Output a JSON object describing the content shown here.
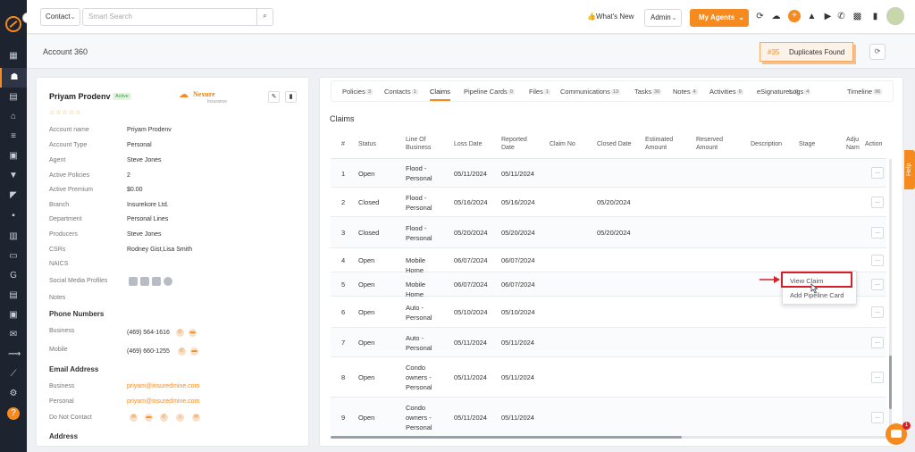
{
  "topbar": {
    "entity_select": "Contact",
    "search_placeholder": "Smart Search",
    "whats_new": "What's New",
    "role_select": "Admin",
    "my_agents": "My Agents",
    "notification_count": "1"
  },
  "subhead": {
    "title": "Account 360",
    "duplicates_count": "#35",
    "duplicates_label": "Duplicates Found"
  },
  "account": {
    "name": "Priyam Prodenv",
    "status": "Active",
    "brand": "Nexure",
    "brand_sub": "Insurance",
    "fields": [
      {
        "label": "Account name",
        "value": "Priyam Prodenv"
      },
      {
        "label": "Account Type",
        "value": "Personal"
      },
      {
        "label": "Agent",
        "value": "Steve Jones"
      },
      {
        "label": "Active Policies",
        "value": "2"
      },
      {
        "label": "Active Premium",
        "value": "$0.00"
      },
      {
        "label": "Branch",
        "value": "Insurekore Ltd."
      },
      {
        "label": "Department",
        "value": "Personal Lines"
      },
      {
        "label": "Producers",
        "value": "Steve Jones"
      },
      {
        "label": "CSRs",
        "value": "Rodney Gist,Lisa Smith"
      },
      {
        "label": "NAICS",
        "value": ""
      }
    ],
    "social_label": "Social Media Profiles",
    "notes_label": "Notes",
    "phone_section": "Phone Numbers",
    "phones": [
      {
        "label": "Business",
        "value": "(469) 564-1616"
      },
      {
        "label": "Mobile",
        "value": "(469) 660-1255"
      }
    ],
    "email_section": "Email Address",
    "emails": [
      {
        "label": "Business",
        "value": "priyam@insuredmine.com"
      },
      {
        "label": "Personal",
        "value": "priyam@insuredmine.com"
      }
    ],
    "dnc_label": "Do Not Contact",
    "address_section": "Address"
  },
  "tabs": [
    {
      "label": "Policies",
      "count": "3"
    },
    {
      "label": "Contacts",
      "count": "1"
    },
    {
      "label": "Claims",
      "count": ""
    },
    {
      "label": "Pipeline Cards",
      "count": "0"
    },
    {
      "label": "Files",
      "count": "1"
    },
    {
      "label": "Communications",
      "count": "13"
    },
    {
      "label": "Tasks",
      "count": "36"
    },
    {
      "label": "Notes",
      "count": "4"
    },
    {
      "label": "Activities",
      "count": "9"
    },
    {
      "label": "eSignatures",
      "count": "0"
    },
    {
      "label": "Logs",
      "count": "4"
    },
    {
      "label": "Timeline",
      "count": "96"
    }
  ],
  "claims": {
    "title": "Claims",
    "headers": {
      "num": "#",
      "status": "Status",
      "lob": "Line Of Business",
      "loss": "Loss Date",
      "reported": "Reported Date",
      "claimno": "Claim No",
      "closed": "Closed Date",
      "est": "Estimated Amount",
      "reserved": "Reserved Amount",
      "desc": "Description",
      "stage": "Stage",
      "adj": "Adju Nam",
      "action": "Action"
    },
    "rows": [
      {
        "num": "1",
        "status": "Open",
        "lob": "Flood - Personal",
        "loss": "05/11/2024",
        "reported": "05/11/2024",
        "closed": ""
      },
      {
        "num": "2",
        "status": "Closed",
        "lob": "Flood - Personal",
        "loss": "05/16/2024",
        "reported": "05/16/2024",
        "closed": "05/20/2024"
      },
      {
        "num": "3",
        "status": "Closed",
        "lob": "Flood - Personal",
        "loss": "05/20/2024",
        "reported": "05/20/2024",
        "closed": "05/20/2024"
      },
      {
        "num": "4",
        "status": "Open",
        "lob": "Mobile Home",
        "loss": "06/07/2024",
        "reported": "06/07/2024",
        "closed": ""
      },
      {
        "num": "5",
        "status": "Open",
        "lob": "Mobile Home",
        "loss": "06/07/2024",
        "reported": "06/07/2024",
        "closed": ""
      },
      {
        "num": "6",
        "status": "Open",
        "lob": "Auto - Personal",
        "loss": "05/10/2024",
        "reported": "05/10/2024",
        "closed": ""
      },
      {
        "num": "7",
        "status": "Open",
        "lob": "Auto - Personal",
        "loss": "05/11/2024",
        "reported": "05/11/2024",
        "closed": ""
      },
      {
        "num": "8",
        "status": "Open",
        "lob": "Condo owners - Personal",
        "loss": "05/11/2024",
        "reported": "05/11/2024",
        "closed": ""
      },
      {
        "num": "9",
        "status": "Open",
        "lob": "Condo owners - Personal",
        "loss": "05/11/2024",
        "reported": "05/11/2024",
        "closed": ""
      }
    ],
    "action_label": "..."
  },
  "context_menu": {
    "view_claim": "View Claim",
    "add_pipeline": "Add Pipeline Card"
  },
  "help_label": "Help",
  "chat_badge": "1",
  "colors": {
    "accent": "#f58a1f",
    "sidebar": "#1e2330",
    "highlight": "#d3202a"
  }
}
